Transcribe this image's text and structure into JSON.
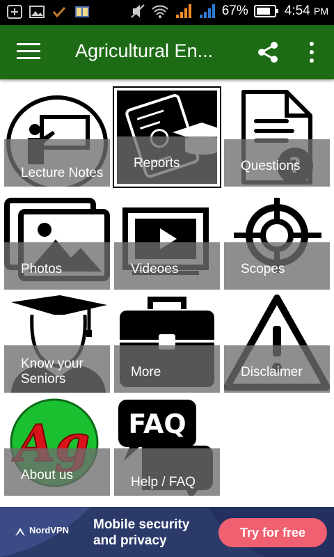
{
  "status_bar": {
    "battery_percent": "67%",
    "time": "4:54",
    "ampm": "PM"
  },
  "app_bar": {
    "title": "Agricultural En..."
  },
  "tiles": [
    {
      "label": "Lecture Notes",
      "icon": "lecture-icon"
    },
    {
      "label": "Reports",
      "icon": "report-icon"
    },
    {
      "label": "Questions",
      "icon": "questions-icon"
    },
    {
      "label": "Photos",
      "icon": "photos-icon"
    },
    {
      "label": "Videoes",
      "icon": "video-icon"
    },
    {
      "label": "Scopes",
      "icon": "scope-icon"
    },
    {
      "label": "Know your Seniors",
      "icon": "graduate-icon"
    },
    {
      "label": "More",
      "icon": "briefcase-icon"
    },
    {
      "label": "Disclaimer",
      "icon": "warning-icon"
    },
    {
      "label": "About us",
      "icon": "ag-logo-icon"
    },
    {
      "label": "Help / FAQ",
      "icon": "faq-icon"
    }
  ],
  "tile_extras": {
    "ag_logo_text": "Ag",
    "faq_icon_text": "FAQ"
  },
  "ad": {
    "brand": "NordVPN",
    "headline": "Mobile security and privacy",
    "cta": "Try for free"
  },
  "colors": {
    "app_bar": "#1d6b15",
    "caption_overlay": "#6e6e6e",
    "ad_background": "#2c3a6a",
    "ad_cta": "#f06070"
  }
}
